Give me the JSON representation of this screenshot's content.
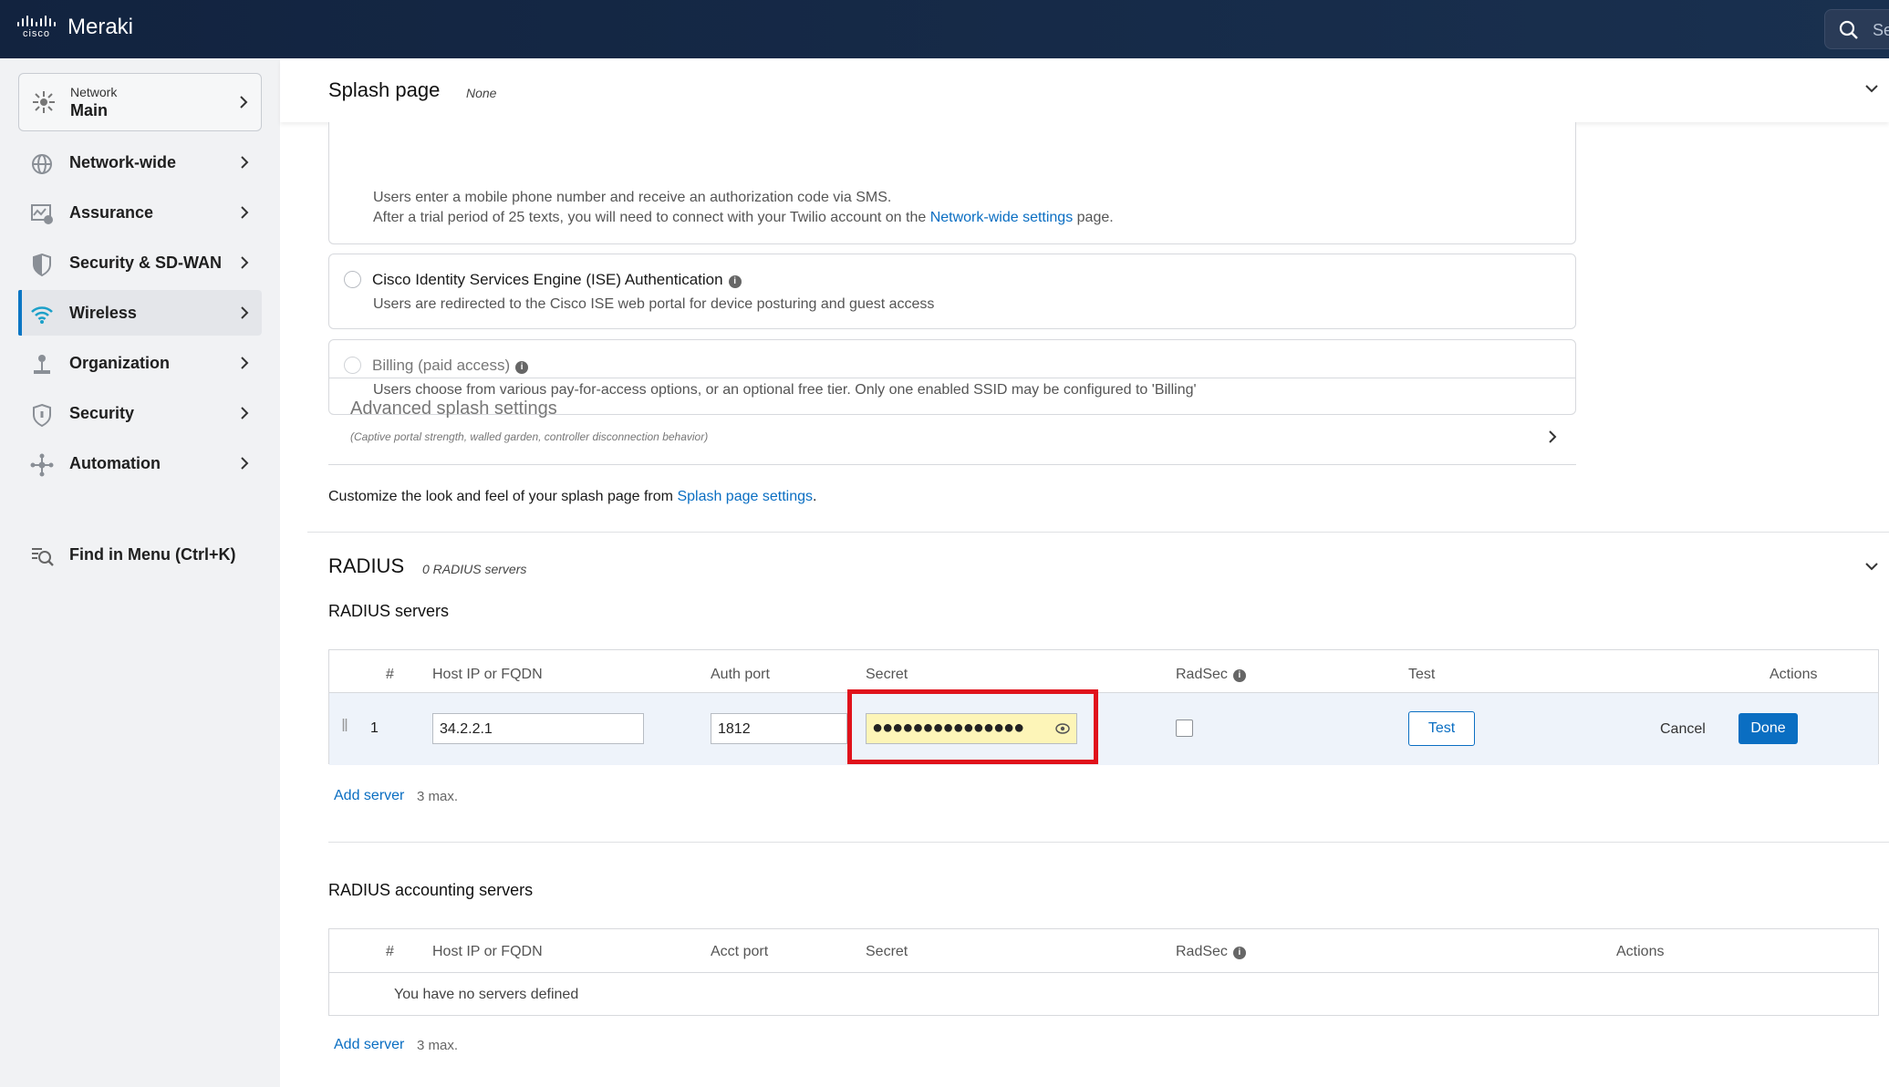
{
  "topbar": {
    "brand_mark": "cisco",
    "brand": "Meraki",
    "search_placeholder": "Se"
  },
  "sidebar": {
    "network_label": "Network",
    "network_value": "Main",
    "items": [
      {
        "label": "Network-wide",
        "icon": "network-wide-icon"
      },
      {
        "label": "Assurance",
        "icon": "assurance-icon"
      },
      {
        "label": "Security & SD-WAN",
        "icon": "shield-half-icon"
      },
      {
        "label": "Wireless",
        "icon": "wifi-icon",
        "active": true
      },
      {
        "label": "Organization",
        "icon": "organization-icon"
      },
      {
        "label": "Security",
        "icon": "shield-icon"
      },
      {
        "label": "Automation",
        "icon": "automation-icon"
      }
    ],
    "find_menu": "Find in Menu (Ctrl+K)"
  },
  "splash": {
    "title": "Splash page",
    "subtitle": "None",
    "sms_desc1": "Users enter a mobile phone number and receive an authorization code via SMS.",
    "sms_desc2_pre": "After a trial period of 25 texts, you will need to connect with your Twilio account on the ",
    "sms_desc2_link": "Network-wide settings",
    "sms_desc2_post": " page.",
    "ise_title": "Cisco Identity Services Engine (ISE) Authentication",
    "ise_desc": "Users are redirected to the Cisco ISE web portal for device posturing and guest access",
    "billing_title": "Billing (paid access)",
    "billing_desc": "Users choose from various pay-for-access options, or an optional free tier. Only one enabled SSID may be configured to 'Billing'",
    "advanced_title": "Advanced splash settings",
    "advanced_sub": "(Captive portal strength, walled garden, controller disconnection behavior)",
    "customize_pre": "Customize the look and feel of your splash page from ",
    "customize_link": "Splash page settings",
    "customize_post": "."
  },
  "radius": {
    "title": "RADIUS",
    "subtitle": "0 RADIUS servers",
    "servers_heading": "RADIUS servers",
    "columns": {
      "num": "#",
      "host": "Host IP or FQDN",
      "auth_port": "Auth port",
      "secret": "Secret",
      "radsec": "RadSec",
      "test": "Test",
      "actions": "Actions"
    },
    "row": {
      "num": "1",
      "host": "34.2.2.1",
      "port": "1812",
      "secret": "●●●●●●●●●●●●●●●",
      "test_button": "Test",
      "cancel": "Cancel",
      "done": "Done"
    },
    "add_server": "Add server",
    "max": "3 max.",
    "accounting_heading": "RADIUS accounting servers",
    "acct_columns": {
      "num": "#",
      "host": "Host IP or FQDN",
      "acct_port": "Acct port",
      "secret": "Secret",
      "radsec": "RadSec",
      "actions": "Actions"
    },
    "acct_empty": "You have no servers defined",
    "acct_add_server": "Add server",
    "acct_max": "3 max."
  },
  "colors": {
    "topbar": "#12233f",
    "accent": "#0a6ec2",
    "highlight": "#e0121b",
    "secret_fill": "#fdf5b8"
  }
}
